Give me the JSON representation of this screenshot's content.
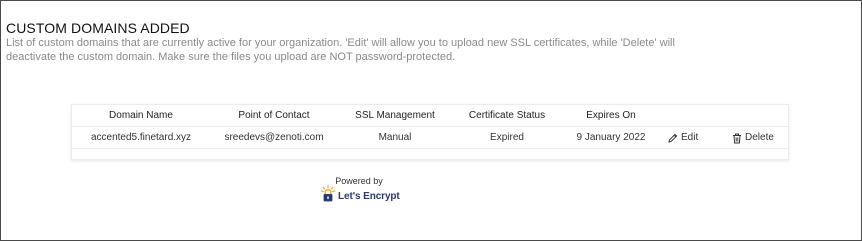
{
  "section": {
    "title": "CUSTOM DOMAINS ADDED",
    "description": "List of custom domains that are currently active for your organization. 'Edit' will allow you to upload new SSL certificates, while 'Delete' will deactivate the custom domain. Make sure the files you upload are NOT password-protected."
  },
  "table": {
    "headers": [
      "Domain Name",
      "Point of Contact",
      "SSL Management",
      "Certificate Status",
      "Expires On"
    ],
    "rows": [
      {
        "domain": "accented5.finetard.xyz",
        "contact": "sreedevs@zenoti.com",
        "ssl": "Manual",
        "status": "Expired",
        "expires": "9 January 2022",
        "edit_label": "Edit",
        "delete_label": "Delete"
      }
    ]
  },
  "footer": {
    "powered_by": "Powered by",
    "brand": "Let's Encrypt"
  },
  "icons": {
    "edit": "pencil-icon",
    "delete": "trash-icon",
    "brand_logo": "lets-encrypt-logo"
  },
  "colors": {
    "text": "#222222",
    "muted": "#8a8a8a",
    "brand_navy": "#2a3a70",
    "brand_gold": "#f5a623"
  }
}
